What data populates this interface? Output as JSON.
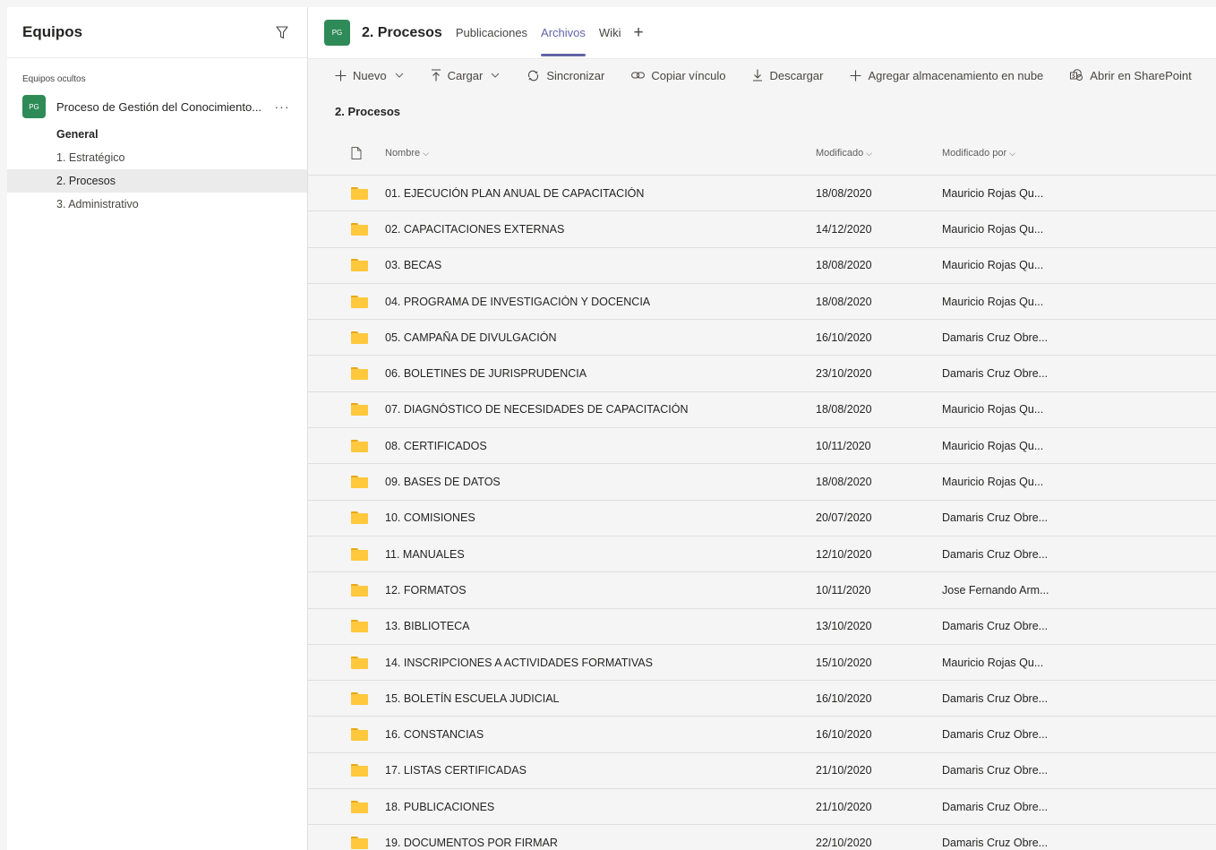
{
  "sidebar": {
    "title": "Equipos",
    "section_label": "Equipos ocultos",
    "team": {
      "avatar": "PG",
      "name": "Proceso de Gestión del Conocimiento...",
      "more": "···"
    },
    "channels": [
      {
        "label": "General",
        "bold": true
      },
      {
        "label": "1. Estratégico"
      },
      {
        "label": "2. Procesos",
        "active": true
      },
      {
        "label": "3. Administrativo"
      }
    ]
  },
  "header": {
    "avatar": "PG",
    "title": "2. Procesos",
    "tabs": [
      {
        "label": "Publicaciones"
      },
      {
        "label": "Archivos",
        "active": true
      },
      {
        "label": "Wiki"
      }
    ],
    "add_tab": "+"
  },
  "toolbar": {
    "nuevo": "Nuevo",
    "cargar": "Cargar",
    "sincronizar": "Sincronizar",
    "copiar": "Copiar vínculo",
    "descargar": "Descargar",
    "agregar": "Agregar almacenamiento en nube",
    "abrir": "Abrir en SharePoint"
  },
  "breadcrumb": "2. Procesos",
  "table": {
    "headers": {
      "name": "Nombre",
      "modified": "Modificado",
      "modified_by": "Modificado por"
    },
    "rows": [
      {
        "name": "01. EJECUCIÓN PLAN ANUAL DE CAPACITACIÓN",
        "modified": "18/08/2020",
        "by": "Mauricio Rojas Qu..."
      },
      {
        "name": "02. CAPACITACIONES EXTERNAS",
        "modified": "14/12/2020",
        "by": "Mauricio Rojas Qu..."
      },
      {
        "name": "03. BECAS",
        "modified": "18/08/2020",
        "by": "Mauricio Rojas Qu..."
      },
      {
        "name": "04. PROGRAMA DE INVESTIGACIÓN Y DOCENCIA",
        "modified": "18/08/2020",
        "by": "Mauricio Rojas Qu..."
      },
      {
        "name": "05. CAMPAÑA DE DIVULGACIÓN",
        "modified": "16/10/2020",
        "by": "Damaris Cruz Obre..."
      },
      {
        "name": "06. BOLETINES DE JURISPRUDENCIA",
        "modified": "23/10/2020",
        "by": "Damaris Cruz Obre..."
      },
      {
        "name": "07. DIAGNÓSTICO DE NECESIDADES DE CAPACITACIÓN",
        "modified": "18/08/2020",
        "by": "Mauricio Rojas Qu..."
      },
      {
        "name": "08. CERTIFICADOS",
        "modified": "10/11/2020",
        "by": "Mauricio Rojas Qu..."
      },
      {
        "name": "09. BASES DE DATOS",
        "modified": "18/08/2020",
        "by": "Mauricio Rojas Qu..."
      },
      {
        "name": "10. COMISIONES",
        "modified": "20/07/2020",
        "by": "Damaris Cruz Obre..."
      },
      {
        "name": "11. MANUALES",
        "modified": "12/10/2020",
        "by": "Damaris Cruz Obre..."
      },
      {
        "name": "12. FORMATOS",
        "modified": "10/11/2020",
        "by": "Jose Fernando Arm..."
      },
      {
        "name": "13. BIBLIOTECA",
        "modified": "13/10/2020",
        "by": "Damaris Cruz Obre..."
      },
      {
        "name": "14. INSCRIPCIONES A ACTIVIDADES FORMATIVAS",
        "modified": "15/10/2020",
        "by": "Mauricio Rojas Qu..."
      },
      {
        "name": "15. BOLETÍN ESCUELA JUDICIAL",
        "modified": "16/10/2020",
        "by": "Damaris Cruz Obre..."
      },
      {
        "name": "16. CONSTANCIAS",
        "modified": "16/10/2020",
        "by": "Damaris Cruz Obre..."
      },
      {
        "name": "17. LISTAS CERTIFICADAS",
        "modified": "21/10/2020",
        "by": "Damaris Cruz Obre..."
      },
      {
        "name": "18. PUBLICACIONES",
        "modified": "21/10/2020",
        "by": "Damaris Cruz Obre..."
      },
      {
        "name": "19. DOCUMENTOS POR FIRMAR",
        "modified": "22/10/2020",
        "by": "Damaris Cruz Obre..."
      }
    ]
  },
  "colors": {
    "accent": "#6264a7",
    "avatar": "#2e8b57",
    "folder": "#ffc83d"
  }
}
